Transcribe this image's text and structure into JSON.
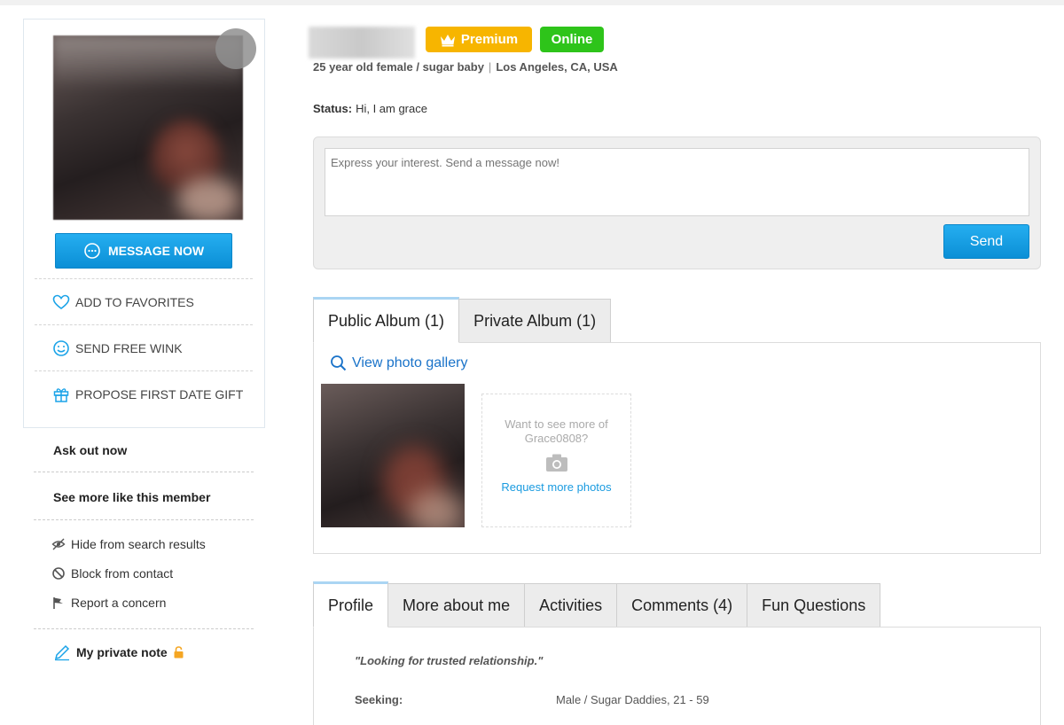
{
  "colors": {
    "accent": "#0b8fd6",
    "premium": "#f7b500",
    "online": "#2ec41a",
    "link": "#1a73c9"
  },
  "card": {
    "message_button": "MESSAGE NOW",
    "actions": [
      {
        "label": "ADD TO FAVORITES",
        "icon": "heart-icon"
      },
      {
        "label": "SEND FREE WINK",
        "icon": "smiley-icon"
      },
      {
        "label": "PROPOSE FIRST DATE GIFT",
        "icon": "gift-icon"
      }
    ]
  },
  "sidebar": {
    "ask_out": "Ask out now",
    "see_more": "See more like this member",
    "hide": "Hide from search results",
    "block": "Block from contact",
    "report": "Report a concern",
    "private_note": "My private note"
  },
  "profile": {
    "badge_premium": "Premium",
    "badge_online": "Online",
    "description": "25 year old female / sugar baby",
    "location": "Los Angeles, CA, USA",
    "status_label": "Status:",
    "status_value": "Hi, I am grace"
  },
  "message": {
    "placeholder": "Express your interest. Send a message now!",
    "send_label": "Send"
  },
  "album": {
    "tabs": [
      "Public Album (1)",
      "Private Album (1)"
    ],
    "gallery_link": "View photo gallery",
    "more_text": "Want to see more of Grace0808?",
    "request_link": "Request more photos"
  },
  "profile_tabs": [
    "Profile",
    "More about me",
    "Activities",
    "Comments (4)",
    "Fun Questions"
  ],
  "profile_panel": {
    "quote": "\"Looking for trusted relationship.\"",
    "seeking_label": "Seeking:",
    "seeking_value": "Male / Sugar Daddies, 21 - 59"
  }
}
